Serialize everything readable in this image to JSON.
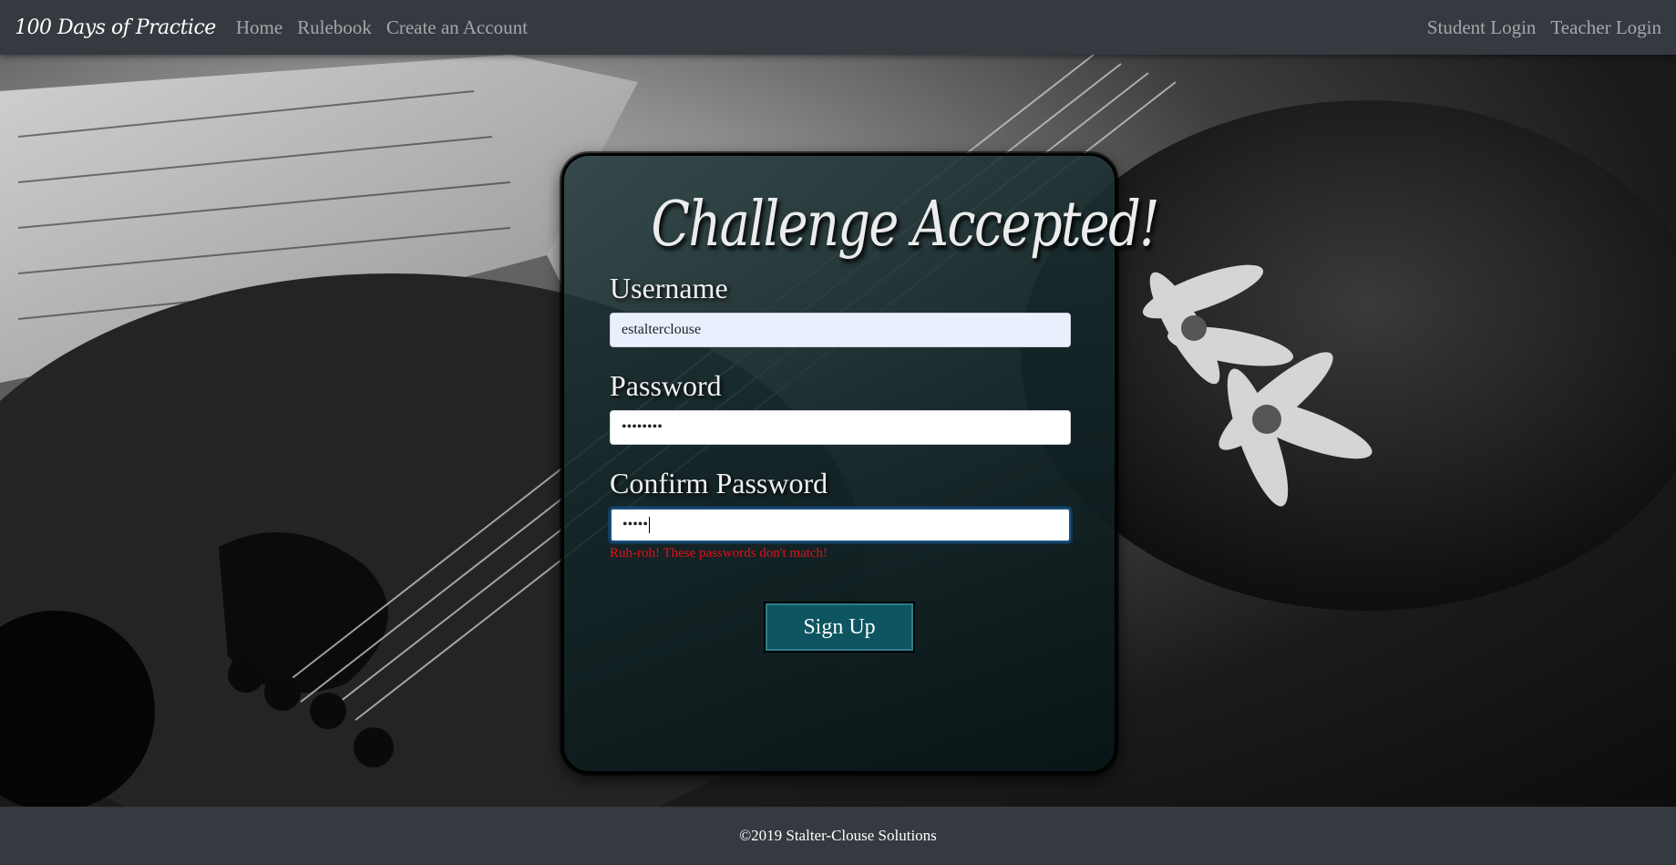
{
  "navbar": {
    "brand": "100 Days of Practice",
    "links": [
      "Home",
      "Rulebook",
      "Create an Account"
    ],
    "right_links": [
      "Student Login",
      "Teacher Login"
    ]
  },
  "form": {
    "title": "Challenge Accepted!",
    "username_label": "Username",
    "username_value": "estalterclouse",
    "password_label": "Password",
    "password_value": "••••••••",
    "confirm_label": "Confirm Password",
    "confirm_value": "•••••",
    "error_message": "Ruh-roh! These passwords don't match!",
    "submit_label": "Sign Up"
  },
  "footer": {
    "text": "©2019 Stalter-Clouse Solutions"
  },
  "colors": {
    "navbar_bg": "#343a40",
    "button_bg": "#0e5461",
    "error": "#e0101a",
    "autofill_bg": "#e8f0fe"
  },
  "background": {
    "image_description_icon": "violin-sheet-music-photo"
  }
}
